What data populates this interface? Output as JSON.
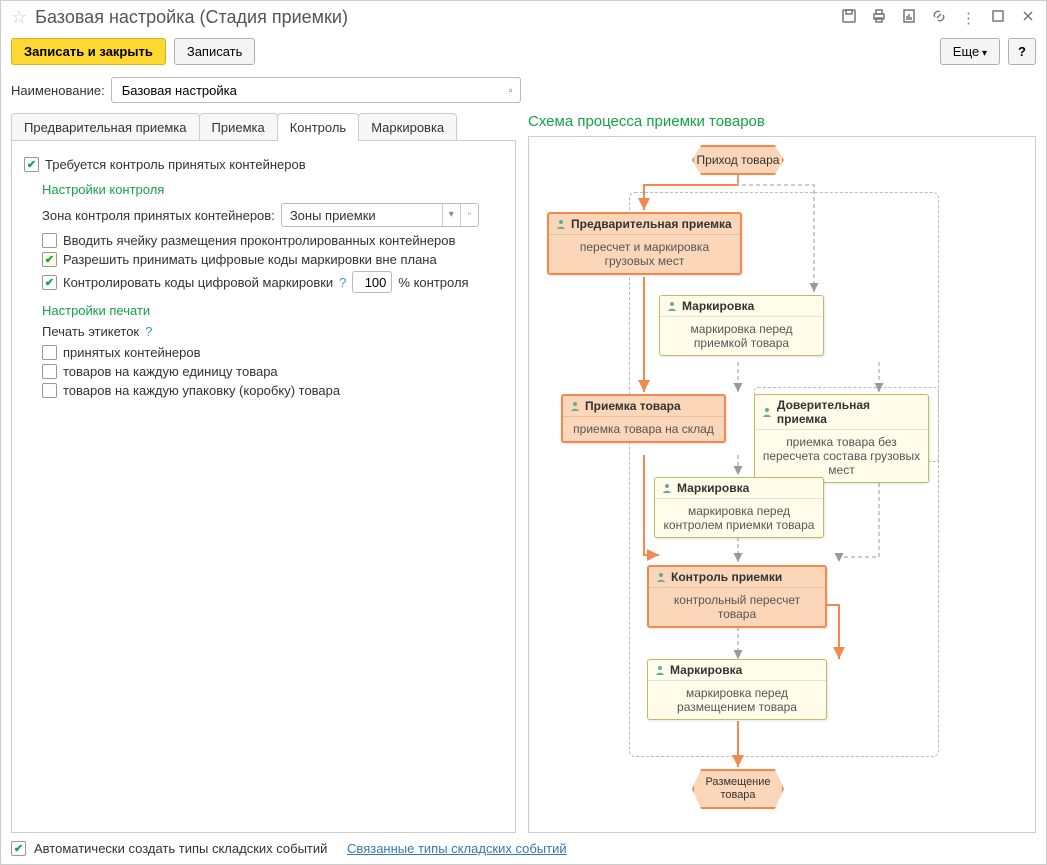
{
  "title": "Базовая настройка (Стадия приемки)",
  "toolbar": {
    "save_close": "Записать и закрыть",
    "save": "Записать",
    "more": "Еще",
    "help": "?"
  },
  "name_label": "Наименование:",
  "name_value": "Базовая настройка",
  "tabs": [
    "Предварительная приемка",
    "Приемка",
    "Контроль",
    "Маркировка"
  ],
  "panel": {
    "require_control": "Требуется контроль принятых контейнеров",
    "control_settings": "Настройки контроля",
    "zone_label": "Зона контроля принятых контейнеров:",
    "zone_value": "Зоны приемки",
    "enter_cell": "Вводить ячейку размещения проконтролированных контейнеров",
    "allow_digital": "Разрешить принимать цифровые коды маркировки вне плана",
    "control_codes": "Контролировать коды цифровой маркировки",
    "percent_value": "100",
    "percent_suffix": "% контроля",
    "print_settings": "Настройки печати",
    "print_labels": "Печать этикеток",
    "print_opt1": "принятых контейнеров",
    "print_opt2": "товаров на каждую единицу товара",
    "print_opt3": "товаров на каждую упаковку (коробку) товара"
  },
  "scheme": {
    "title": "Схема процесса приемки товаров",
    "start": "Приход товара",
    "n1_h": "Предварительная приемка",
    "n1_b": "пересчет и маркировка грузовых мест",
    "n2_h": "Маркировка",
    "n2_b": "маркировка перед приемкой товара",
    "n3_h": "Приемка товара",
    "n3_b": "приемка товара на склад",
    "n4_h": "Доверительная приемка",
    "n4_b": "приемка товара без пересчета состава грузовых мест",
    "n5_h": "Маркировка",
    "n5_b": "маркировка перед контролем приемки товара",
    "n6_h": "Контроль приемки",
    "n6_b": "контрольный пересчет товара",
    "n7_h": "Маркировка",
    "n7_b": "маркировка перед размещением товара",
    "end": "Размещение товара"
  },
  "footer": {
    "auto_create": "Автоматически создать типы складских событий",
    "link": "Связанные типы складских событий"
  }
}
